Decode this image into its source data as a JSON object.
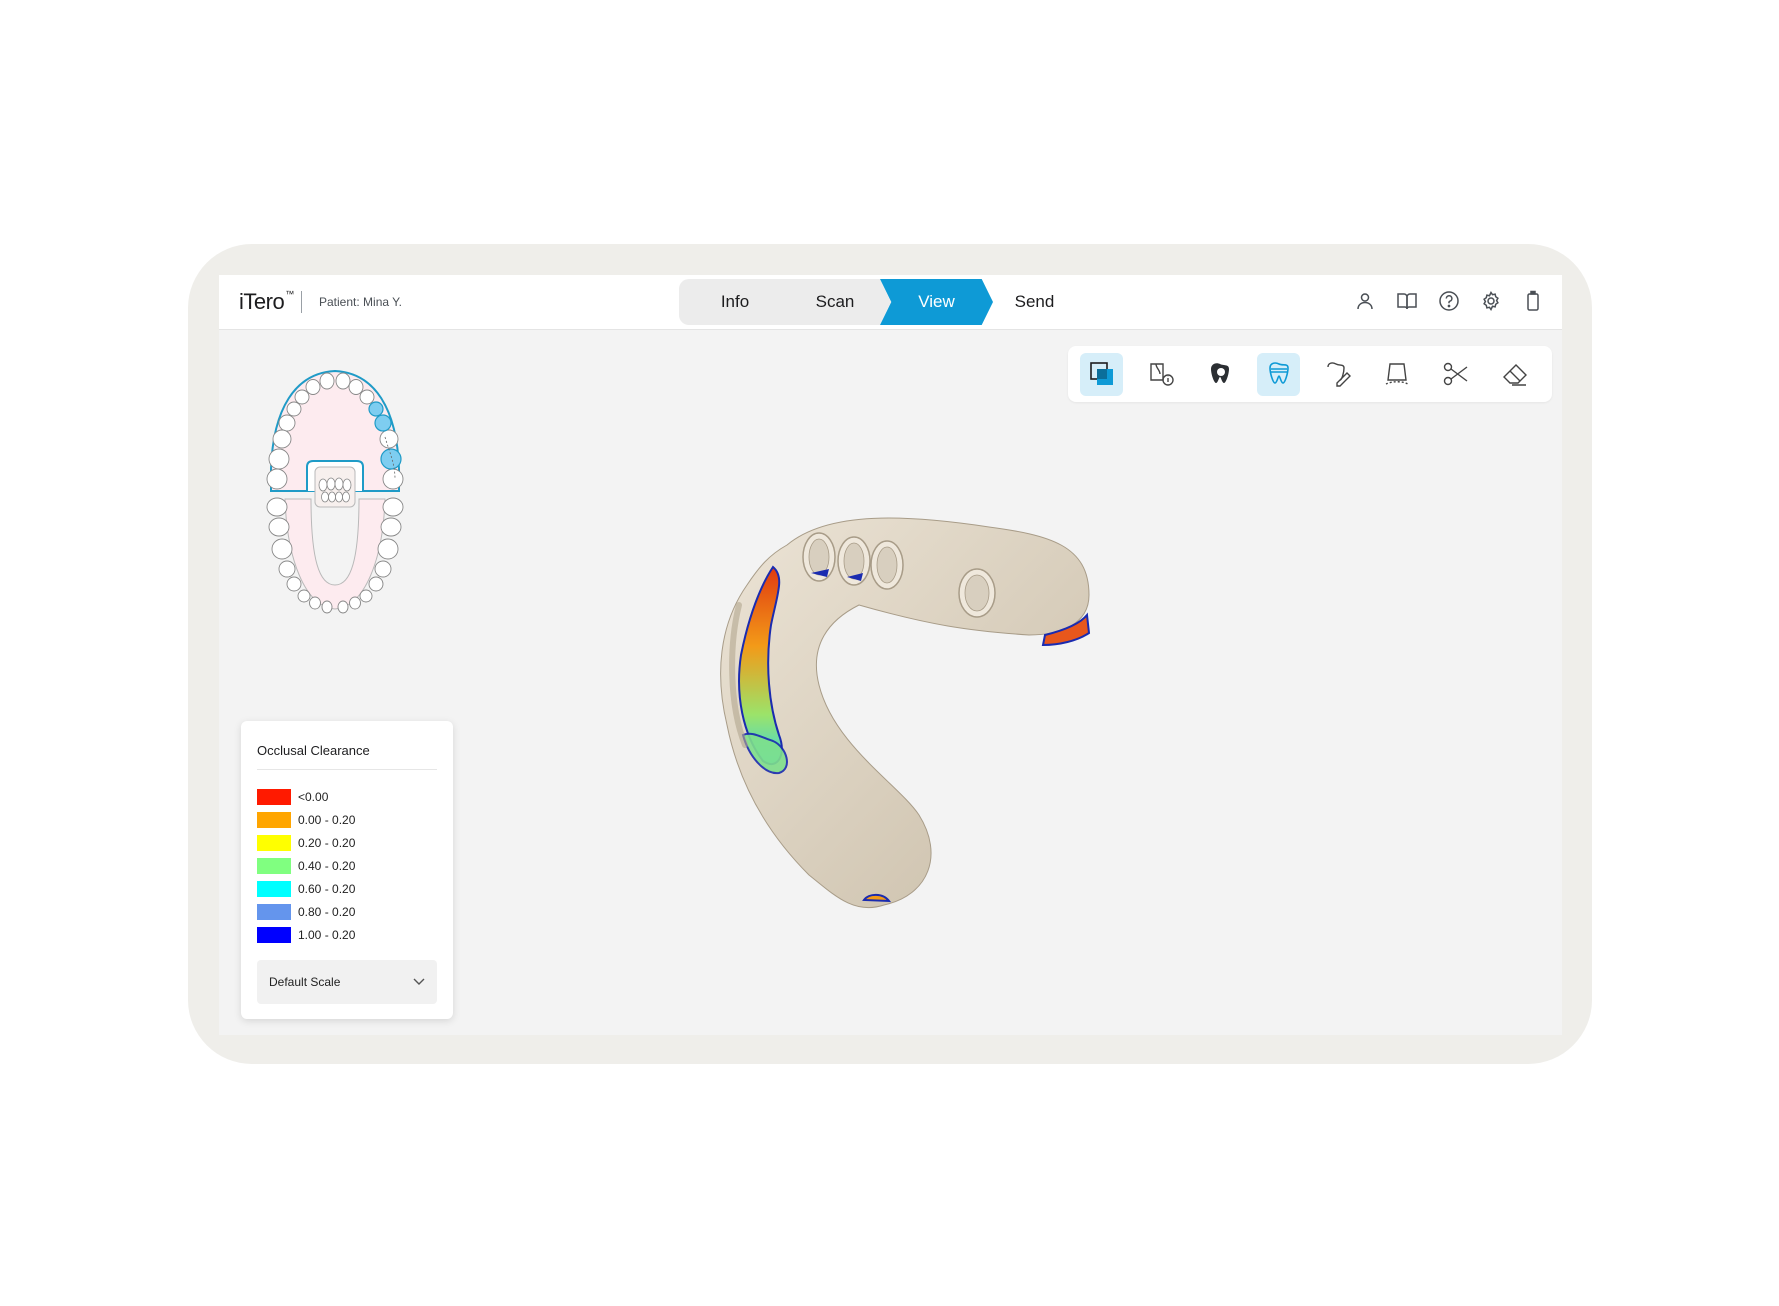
{
  "app": {
    "logo": "iTero",
    "trademark": "™",
    "patient": "Patient: Mina Y."
  },
  "steps": [
    {
      "label": "Info",
      "state": "done"
    },
    {
      "label": "Scan",
      "state": "done"
    },
    {
      "label": "View",
      "state": "active"
    },
    {
      "label": "Send",
      "state": "pending"
    }
  ],
  "header_icons": [
    "user-icon",
    "book-icon",
    "help-icon",
    "settings-icon",
    "battery-icon"
  ],
  "toolbar": [
    {
      "icon": "layers-icon",
      "active": true
    },
    {
      "icon": "review-info-icon",
      "active": false
    },
    {
      "icon": "tooth-search-icon",
      "active": false
    },
    {
      "icon": "occlusal-clearance-icon",
      "active": true
    },
    {
      "icon": "tooth-edit-icon",
      "active": false
    },
    {
      "icon": "margin-line-icon",
      "active": false
    },
    {
      "icon": "scissors-icon",
      "active": false
    },
    {
      "icon": "eraser-icon",
      "active": false
    }
  ],
  "legend": {
    "title": "Occlusal Clearance",
    "items": [
      {
        "label": "<0.00",
        "color": "#ff1a00"
      },
      {
        "label": "0.00 - 0.20",
        "color": "#ffa500"
      },
      {
        "label": "0.20 - 0.20",
        "color": "#ffff00"
      },
      {
        "label": "0.40 - 0.20",
        "color": "#80ff80"
      },
      {
        "label": "0.60 - 0.20",
        "color": "#00ffff"
      },
      {
        "label": "0.80 - 0.20",
        "color": "#6495ed"
      },
      {
        "label": "1.00 - 0.20",
        "color": "#0000ff"
      }
    ],
    "scale_select": {
      "value": "Default Scale"
    }
  },
  "colors": {
    "accent": "#0e9ad6",
    "tooth_selected": "#7ecdf0",
    "model": "#ddd3c2"
  }
}
